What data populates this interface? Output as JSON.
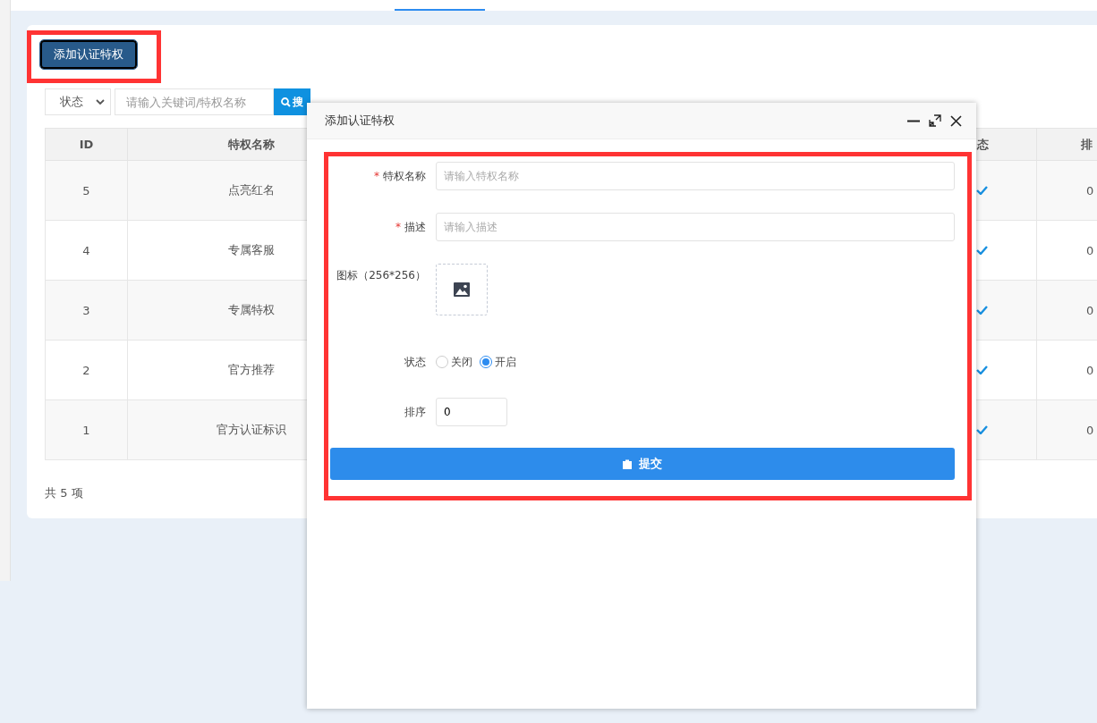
{
  "toolbar": {
    "add_button": "添加认证特权"
  },
  "filter": {
    "status_select": "状态",
    "search": {
      "placeholder": "请输入关键词/特权名称"
    },
    "search_button": "搜"
  },
  "table": {
    "columns": [
      "ID",
      "特权名称",
      "态",
      "排"
    ],
    "rows": [
      {
        "id": "5",
        "name": "点亮红名",
        "enabled": true,
        "sort": "0"
      },
      {
        "id": "4",
        "name": "专属客服",
        "enabled": true,
        "sort": "0"
      },
      {
        "id": "3",
        "name": "专属特权",
        "enabled": true,
        "sort": "0"
      },
      {
        "id": "2",
        "name": "官方推荐",
        "enabled": true,
        "sort": "0"
      },
      {
        "id": "1",
        "name": "官方认证标识",
        "enabled": true,
        "sort": "0"
      }
    ]
  },
  "footer": {
    "total": "共 5 项"
  },
  "dialog": {
    "title": "添加认证特权",
    "fields": [
      {
        "kind": "text",
        "label": "特权名称",
        "required_mark": "*",
        "placeholder": "请输入特权名称"
      },
      {
        "kind": "text",
        "label": "描述",
        "required_mark": "*",
        "placeholder": "请输入描述"
      },
      {
        "kind": "image",
        "label": "图标（256*256）"
      },
      {
        "kind": "radio",
        "label": "状态",
        "options": [
          {
            "label": "关闭",
            "selected": false
          },
          {
            "label": "开启",
            "selected": true
          }
        ]
      },
      {
        "kind": "number",
        "label": "排序",
        "value": "0"
      }
    ],
    "submit": "提交"
  }
}
